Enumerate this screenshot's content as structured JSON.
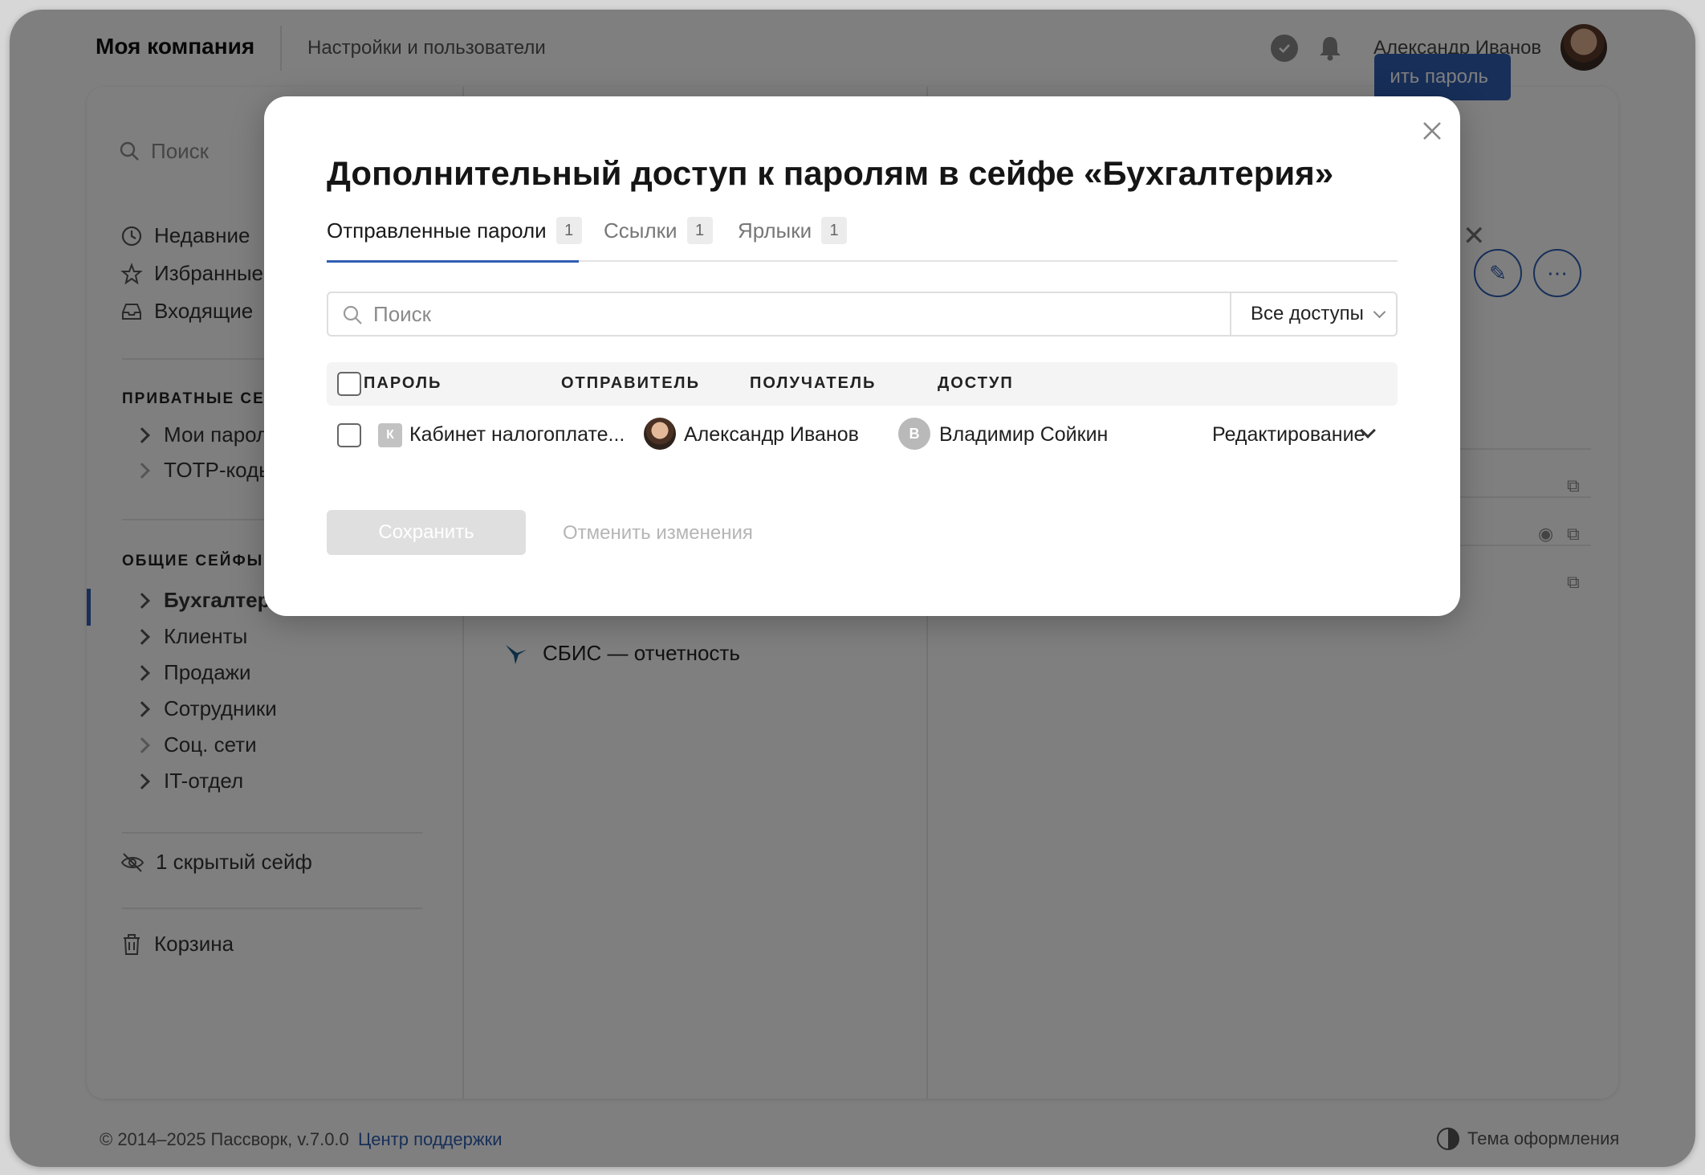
{
  "topbar": {
    "brand": "Моя компания",
    "section": "Настройки и пользователи",
    "username": "Александр Иванов",
    "icons": [
      "check-circle-icon",
      "bell-icon"
    ]
  },
  "sidebar": {
    "search_placeholder": "Поиск",
    "quick": [
      {
        "label": "Недавние",
        "icon": "clock-icon"
      },
      {
        "label": "Избранные",
        "icon": "star-icon"
      },
      {
        "label": "Входящие",
        "icon": "inbox-icon"
      }
    ],
    "private_heading": "ПРИВАТНЫЕ СЕЙ",
    "private_items": [
      "Мои парол",
      "TOTP-коды"
    ],
    "shared_heading": "ОБЩИЕ СЕЙФЫ",
    "shared_items": [
      "Бухгалтери",
      "Клиенты",
      "Продажи",
      "Сотрудники",
      "Соц. сети",
      "IT-отдел"
    ],
    "hidden": "1 скрытый сейф",
    "trash": "Корзина"
  },
  "middle": {
    "sbis": "СБИС — отчетность"
  },
  "right": {
    "add_button": "ить пароль"
  },
  "footer": {
    "copyright": "© 2014–2025 Пассворк, v.7.0.0",
    "support": "Центр поддержки",
    "theme": "Тема оформления"
  },
  "modal": {
    "title": "Дополнительный доступ к паролям в сейфе «Бухгалтерия»",
    "tabs": [
      {
        "label": "Отправленные пароли",
        "count": "1",
        "active": true
      },
      {
        "label": "Ссылки",
        "count": "1",
        "active": false
      },
      {
        "label": "Ярлыки",
        "count": "1",
        "active": false
      }
    ],
    "search_placeholder": "Поиск",
    "filter_label": "Все доступы",
    "columns": [
      "ПАРОЛЬ",
      "ОТПРАВИТЕЛЬ",
      "ПОЛУЧАТЕЛЬ",
      "ДОСТУП"
    ],
    "rows": [
      {
        "badge": "К",
        "password": "Кабинет налогоплате...",
        "sender": "Александр Иванов",
        "recipient_initial": "В",
        "recipient": "Владимир Сойкин",
        "access": "Редактирование"
      }
    ],
    "save_label": "Сохранить",
    "cancel_label": "Отменить изменения"
  },
  "colors": {
    "accent": "#2f5fb3",
    "overlay": "rgba(0,0,0,0.5)"
  }
}
